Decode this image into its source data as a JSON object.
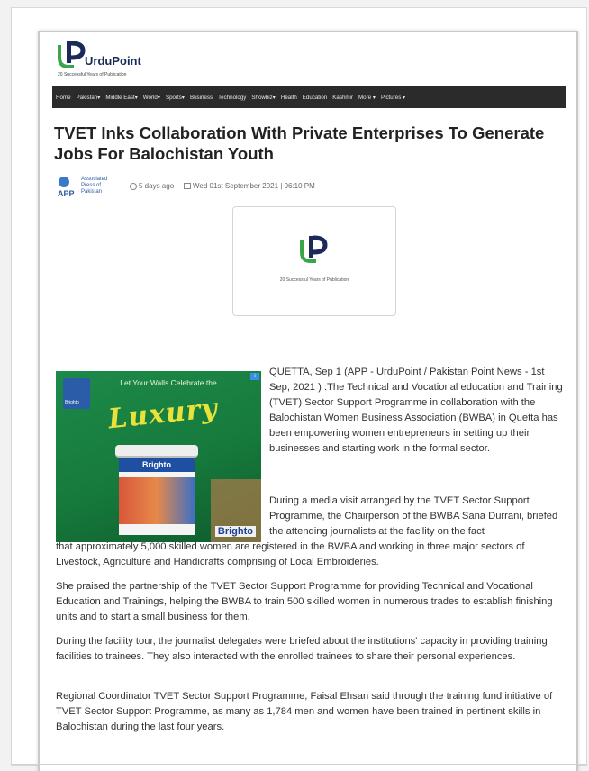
{
  "header": {
    "logo_text": "UrduPoint",
    "logo_tagline": "20 Successful Years of Publication"
  },
  "nav": {
    "items": [
      "Home",
      "Pakistan",
      "Middle East",
      "World",
      "Sports",
      "Business",
      "Technology",
      "Showbiz",
      "Health",
      "Education",
      "Kashmir",
      "More",
      "Pictures"
    ]
  },
  "article": {
    "headline": "TVET Inks Collaboration With Private Enterprises To Generate Jobs For Balochistan Youth",
    "source_name": "Associated Press of Pakistan",
    "source_abbr": "APP",
    "time_ago": "5 days ago",
    "date": "Wed 01st September 2021 | 06:10 PM",
    "placeholder_tagline": "20 Successful Years of Publication",
    "p1": "QUETTA, Sep 1 (APP - UrduPoint / Pakistan Point News - 1st Sep, 2021 ) :The Technical and Vocational education and Training (TVET) Sector Support Programme in collaboration with the Balochistan Women Business Association (BWBA) in Quetta has been empowering women entrepreneurs in setting up their businesses and starting work in the formal sector.",
    "p2_head": "During a media visit arranged by the TVET Sector Support Programme, the Chairperson of the BWBA Sana Durrani, briefed the attending journalists at the facility on the fact",
    "p2_tail": "that approximately 5,000 skilled women are registered in the BWBA and working in three major sectors of Livestock, Agriculture and Handicrafts comprising of Local Embroideries.",
    "p3": "She praised the partnership of the TVET Sector Support Programme for providing Technical and Vocational Education and Trainings, helping the BWBA to train 500 skilled women in numerous trades to establish finishing units and to start a small business for them.",
    "p4": "During the facility tour, the journalist delegates were briefed about the institutions' capacity in providing training facilities to trainees. They also interacted with the enrolled trainees to share their personal experiences.",
    "p5": "Regional Coordinator TVET Sector Support Programme, Faisal Ehsan said through the training fund initiative of TVET Sector Support Programme, as many as 1,784 men and women have been trained in pertinent skills in Balochistan during the last four years."
  },
  "ad": {
    "line1": "Let Your Walls Celebrate the",
    "headline": "Luxury",
    "product": "Brighto",
    "brand": "Brighto",
    "tile_label": "Brighto",
    "badge": "i"
  },
  "colors": {
    "nav_bg": "#2b2b2b",
    "logo_green": "#3aa54a",
    "logo_navy": "#1b2a5a",
    "ad_green": "#1d8a4a",
    "ad_yellow": "#e8e23a"
  }
}
